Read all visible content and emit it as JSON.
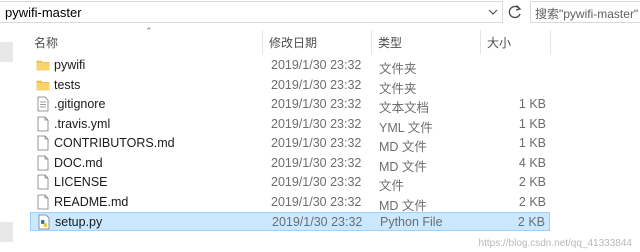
{
  "address_bar": {
    "path": "pywifi-master"
  },
  "search": {
    "placeholder": "搜索\"pywifi-master\""
  },
  "columns": {
    "name": "名称",
    "date": "修改日期",
    "type": "类型",
    "size": "大小"
  },
  "files": [
    {
      "name": "pywifi",
      "date": "2019/1/30 23:32",
      "type": "文件夹",
      "size": "",
      "icon": "folder-icon"
    },
    {
      "name": "tests",
      "date": "2019/1/30 23:32",
      "type": "文件夹",
      "size": "",
      "icon": "folder-icon"
    },
    {
      "name": ".gitignore",
      "date": "2019/1/30 23:32",
      "type": "文本文档",
      "size": "1 KB",
      "icon": "text-file-icon"
    },
    {
      "name": ".travis.yml",
      "date": "2019/1/30 23:32",
      "type": "YML 文件",
      "size": "1 KB",
      "icon": "file-icon"
    },
    {
      "name": "CONTRIBUTORS.md",
      "date": "2019/1/30 23:32",
      "type": "MD 文件",
      "size": "1 KB",
      "icon": "file-icon"
    },
    {
      "name": "DOC.md",
      "date": "2019/1/30 23:32",
      "type": "MD 文件",
      "size": "4 KB",
      "icon": "file-icon"
    },
    {
      "name": "LICENSE",
      "date": "2019/1/30 23:32",
      "type": "文件",
      "size": "2 KB",
      "icon": "file-icon"
    },
    {
      "name": "README.md",
      "date": "2019/1/30 23:32",
      "type": "MD 文件",
      "size": "2 KB",
      "icon": "file-icon"
    },
    {
      "name": "setup.py",
      "date": "2019/1/30 23:32",
      "type": "Python File",
      "size": "2 KB",
      "icon": "python-file-icon",
      "selected": true
    }
  ],
  "watermark": "https://blog.csdn.net/qq_41333844",
  "colors": {
    "selection_bg": "#cce8ff",
    "selection_border": "#99d1ff",
    "folder": "#f5c842"
  }
}
